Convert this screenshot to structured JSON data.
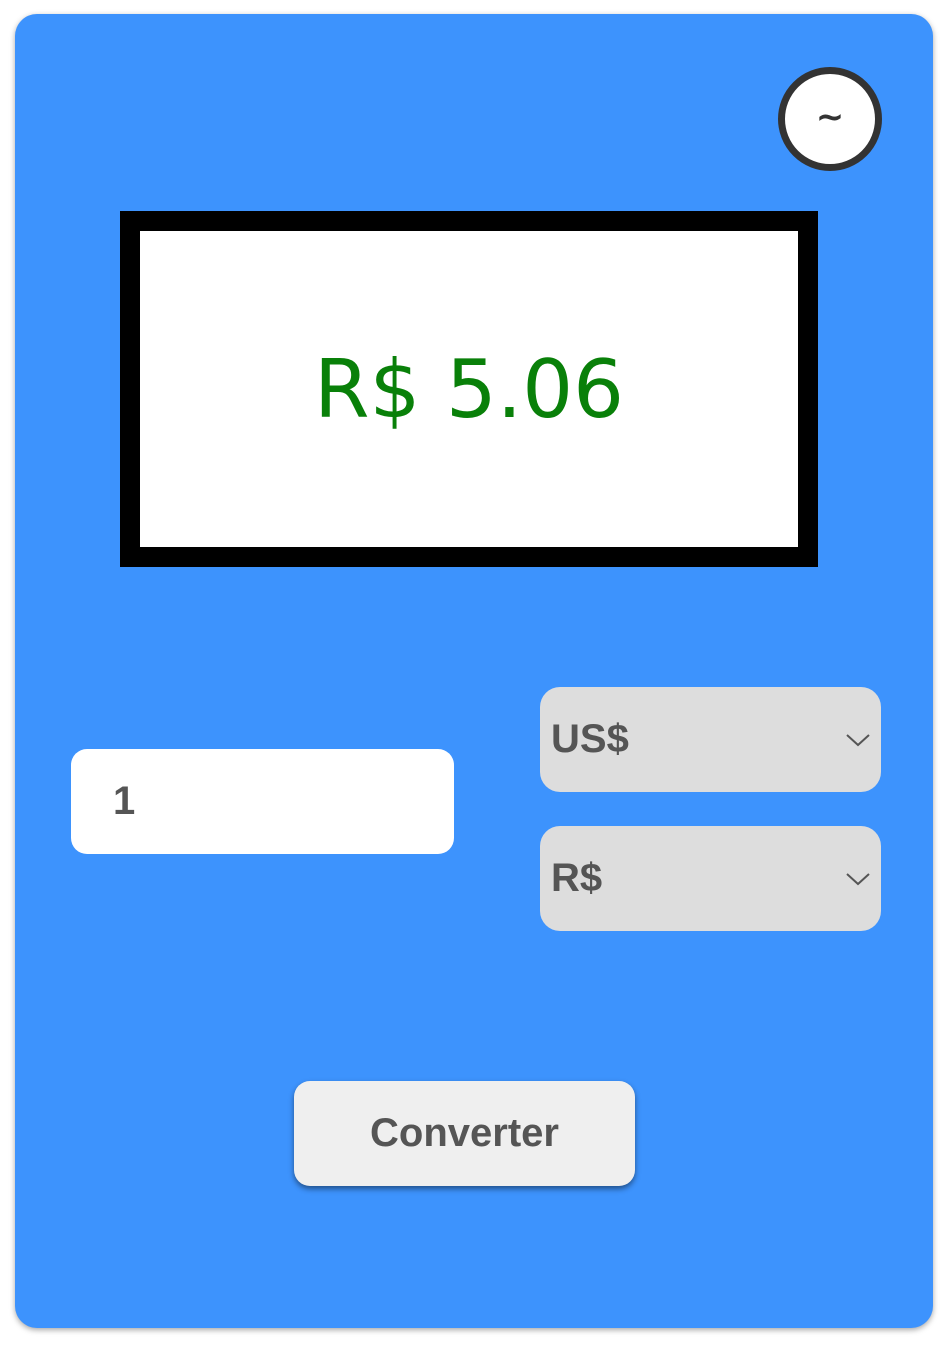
{
  "converter": {
    "swap_icon": "~",
    "swap_icon_name": "tilde-icon",
    "result": "R$ 5.06",
    "amount_value": "1",
    "from_currency": "US$",
    "to_currency": "R$",
    "convert_label": "Converter"
  },
  "colors": {
    "background": "#3d93fd",
    "result_text": "#098009",
    "select_bg": "#dddddd",
    "button_bg": "#efefef",
    "text_gray": "#555555"
  }
}
